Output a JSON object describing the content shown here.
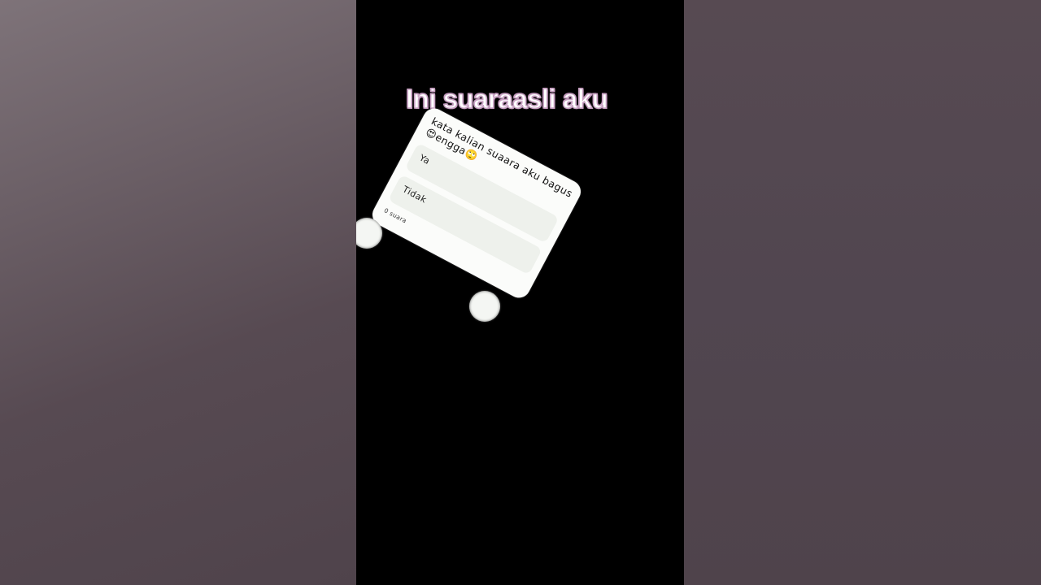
{
  "video": {
    "caption": "Ini suaraasli aku"
  },
  "poll": {
    "question": "kata kalian suaara aku bagus😍engga🙄",
    "options": [
      {
        "label": "Ya"
      },
      {
        "label": "Tidak"
      }
    ],
    "vote_count": "0 suara"
  },
  "colors": {
    "caption_fill": "#ffffff",
    "caption_outline": "#c9a3c4",
    "poll_background": "#fbfcfa",
    "option_background": "#eef1ec",
    "side_blur": "#574a52"
  },
  "icons": {
    "handle_left": "resize-handle-icon",
    "handle_bottom": "resize-handle-icon"
  }
}
